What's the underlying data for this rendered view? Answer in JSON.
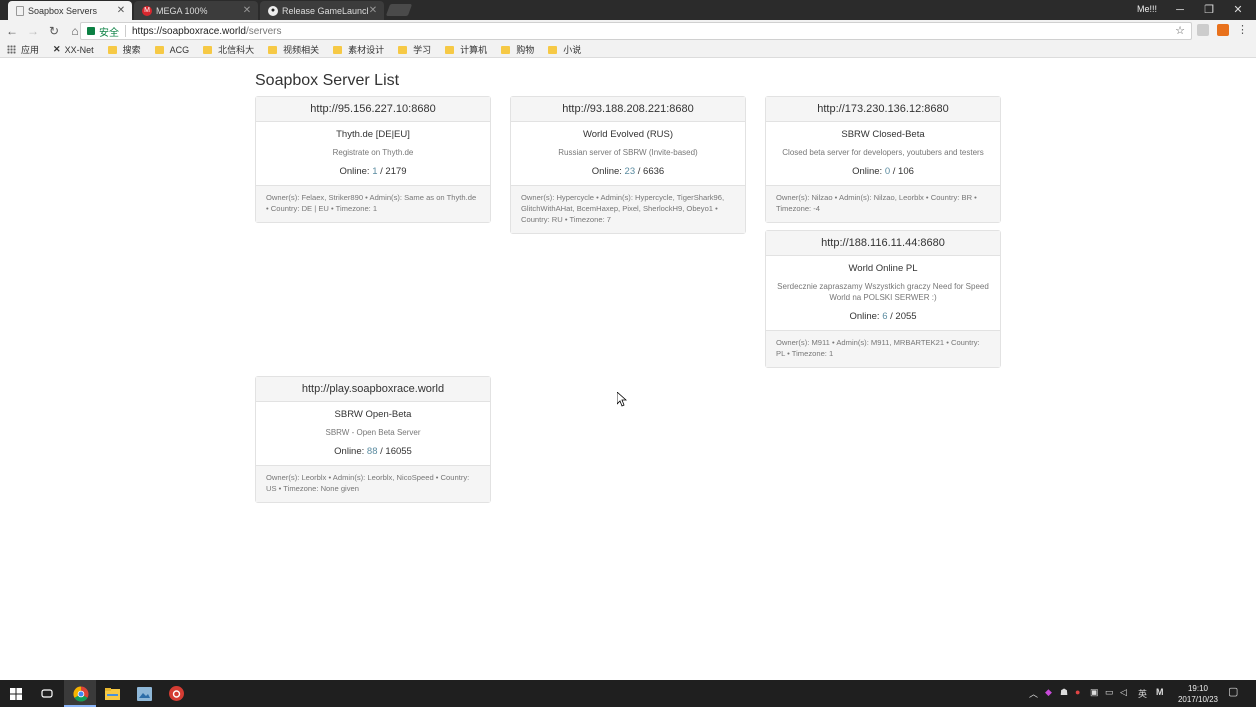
{
  "browser": {
    "tabs": [
      {
        "label": "Soapbox Servers",
        "active": true
      },
      {
        "label": "MEGA 100%",
        "active": false
      },
      {
        "label": "Release GameLauncher",
        "active": false
      }
    ],
    "user": "Me!!!",
    "address": {
      "secure_label": "安全",
      "host": "https://soapboxrace.world",
      "path": "/servers"
    },
    "bookmarks": [
      {
        "label": "应用"
      },
      {
        "label": "XX-Net"
      },
      {
        "label": "搜索"
      },
      {
        "label": "ACG"
      },
      {
        "label": "北信科大"
      },
      {
        "label": "视频相关"
      },
      {
        "label": "素材设计"
      },
      {
        "label": "学习"
      },
      {
        "label": "计算机"
      },
      {
        "label": "购物"
      },
      {
        "label": "小说"
      }
    ]
  },
  "page": {
    "title": "Soapbox Server List",
    "servers": [
      {
        "address": "http://95.156.227.10:8680",
        "name": "Thyth.de [DE|EU]",
        "description": "Registrate on Thyth.de",
        "online_label": "Online:",
        "online_current": "1",
        "online_max": "2179",
        "details": "Owner(s): Felaex, Striker890 • Admin(s): Same as on Thyth.de • Country: DE | EU • Timezone: 1"
      },
      {
        "address": "http://93.188.208.221:8680",
        "name": "World Evolved (RUS)",
        "description": "Russian server of SBRW (Invite-based)",
        "online_label": "Online:",
        "online_current": "23",
        "online_max": "6636",
        "details": "Owner(s): Hypercycle • Admin(s): Hypercycle, TigerShark96, GlitchWithAHat, BcemHaxep, Pixel, SherlockH9, Obeyo1 • Country: RU • Timezone: 7"
      },
      {
        "address": "http://173.230.136.12:8680",
        "name": "SBRW Closed-Beta",
        "description": "Closed beta server for developers, youtubers and testers",
        "online_label": "Online:",
        "online_current": "0",
        "online_max": "106",
        "details": "Owner(s): Nilzao • Admin(s): Nilzao, Leorblx • Country: BR • Timezone: -4"
      },
      {
        "address": "http://188.116.11.44:8680",
        "name": "World Online PL",
        "description": "Serdecznie zapraszamy Wszystkich graczy Need for Speed World na POLSKI SERWER :)",
        "online_label": "Online:",
        "online_current": "6",
        "online_max": "2055",
        "details": "Owner(s): M911 • Admin(s): M911, MRBARTEK21 • Country: PL • Timezone: 1"
      },
      {
        "address": "http://play.soapboxrace.world",
        "name": "SBRW Open-Beta",
        "description": "SBRW - Open Beta Server",
        "online_label": "Online:",
        "online_current": "88",
        "online_max": "16055",
        "details": "Owner(s): Leorblx • Admin(s): Leorblx, NicoSpeed • Country: US • Timezone: None given"
      }
    ]
  },
  "taskbar": {
    "ime": "英",
    "time": "19:10",
    "date": "2017/10/23"
  },
  "colors": {
    "online_current": "#5a8ba0",
    "secure": "#0b8043"
  }
}
